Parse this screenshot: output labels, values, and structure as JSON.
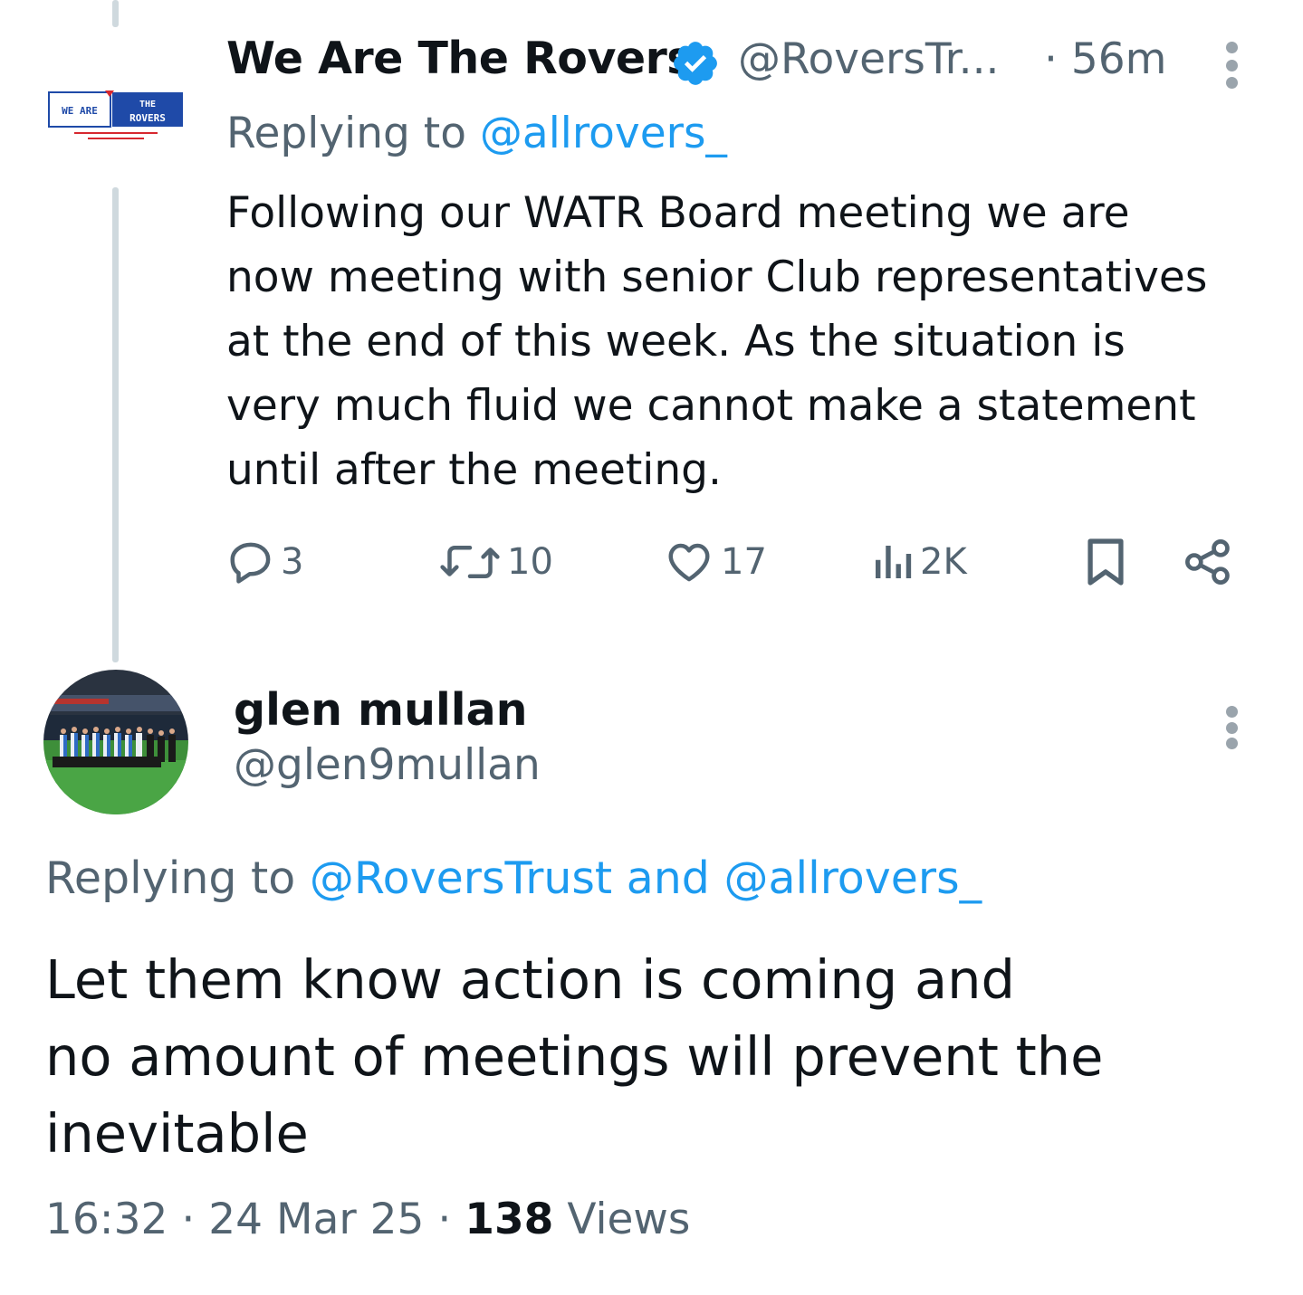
{
  "parent_tweet": {
    "avatar_text": {
      "left": "WE ARE",
      "right_top": "THE",
      "right_bottom": "ROVERS",
      "tagline": "BLACKBURN ROVERS FAN AFFILIATED SUPPORTERS TRUST"
    },
    "display_name": "We Are The Rovers",
    "handle": "@RoversTr...",
    "time": "· 56m",
    "replying_prefix": "Replying to ",
    "replying_to": "@allrovers_",
    "body_lines": [
      "Following our WATR Board meeting we are",
      "now meeting with senior Club representatives",
      "at the end of this week.  As the situation is",
      "very much fluid we cannot make a statement",
      "until after the meeting."
    ],
    "actions": {
      "replies": "3",
      "retweets": "10",
      "likes": "17",
      "views": "2K"
    }
  },
  "reply_tweet": {
    "display_name": "glen mullan",
    "handle": "@glen9mullan",
    "replying_prefix": "Replying to ",
    "replying_to": "@RoversTrust and @allrovers_",
    "body_lines": [
      "Let them know action is coming and",
      "no amount of meetings will prevent the",
      "inevitable"
    ],
    "meta": {
      "time": "16:32",
      "sep1": " · ",
      "date": "24 Mar 25",
      "sep2": " · ",
      "views_count": "138",
      "views_label": " Views"
    }
  },
  "colors": {
    "text": "#0f1419",
    "secondary": "#536471",
    "link": "#1d9bf0",
    "thread_line": "#cfd9de",
    "verified": "#1d9bf0"
  }
}
